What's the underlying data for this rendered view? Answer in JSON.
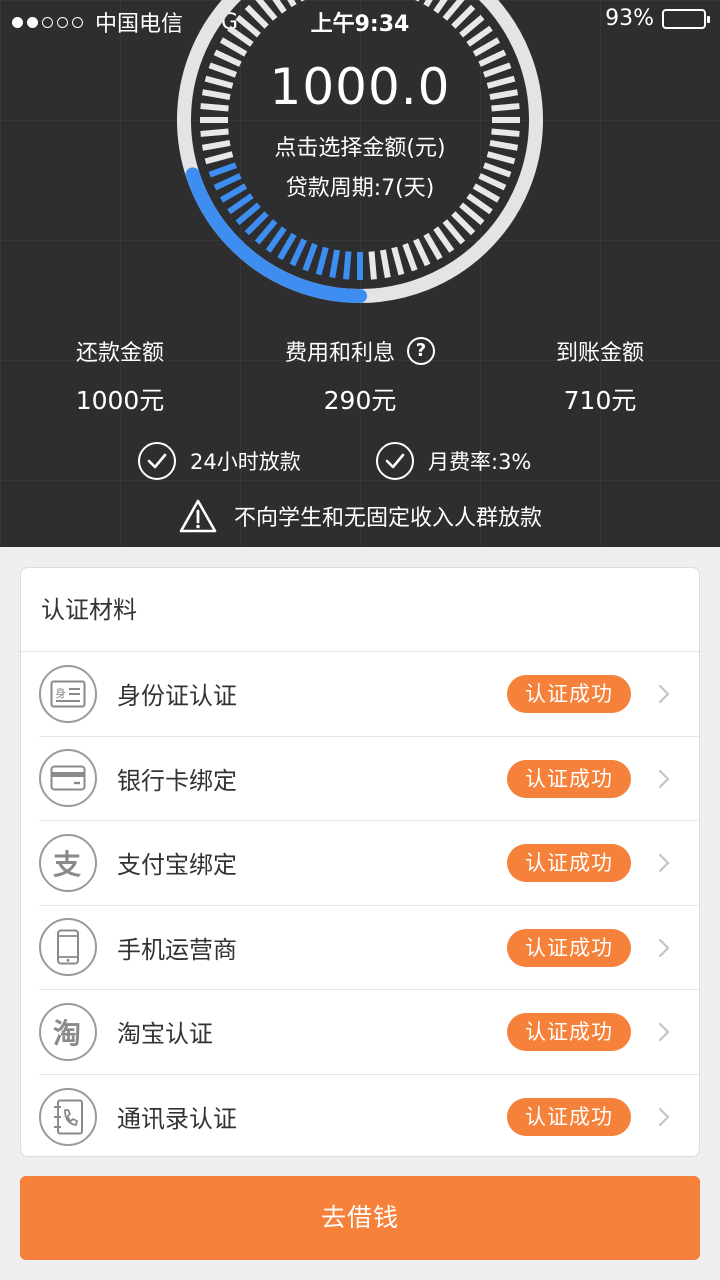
{
  "status_bar": {
    "carrier": "中国电信",
    "network": "4G",
    "time": "上午9:34",
    "battery": "93%",
    "battery_level": 0.93
  },
  "loan": {
    "amount": "1000.0",
    "select_hint": "点击选择金额(元)",
    "period": "贷款周期:7(天)",
    "progress_fraction": 0.2
  },
  "stats": [
    {
      "label": "还款金额",
      "value": "1000元"
    },
    {
      "label": "费用和利息",
      "value": "290元"
    },
    {
      "label": "到账金额",
      "value": "710元"
    }
  ],
  "features": [
    {
      "text": "24小时放款"
    },
    {
      "text": "月费率:3%"
    }
  ],
  "warning": "不向学生和无固定收入人群放款",
  "auth_section": {
    "title": "认证材料",
    "items": [
      {
        "label": "身份证认证",
        "status": "认证成功",
        "icon": "id-card-icon"
      },
      {
        "label": "银行卡绑定",
        "status": "认证成功",
        "icon": "bank-card-icon"
      },
      {
        "label": "支付宝绑定",
        "status": "认证成功",
        "icon": "alipay-icon"
      },
      {
        "label": "手机运营商",
        "status": "认证成功",
        "icon": "phone-icon"
      },
      {
        "label": "淘宝认证",
        "status": "认证成功",
        "icon": "taobao-icon"
      },
      {
        "label": "通讯录认证",
        "status": "认证成功",
        "icon": "contacts-icon"
      }
    ]
  },
  "cta_label": "去借钱",
  "colors": {
    "header_bg": "#2e2e30",
    "accent": "#f5813a",
    "progress": "#3d8ef0"
  }
}
